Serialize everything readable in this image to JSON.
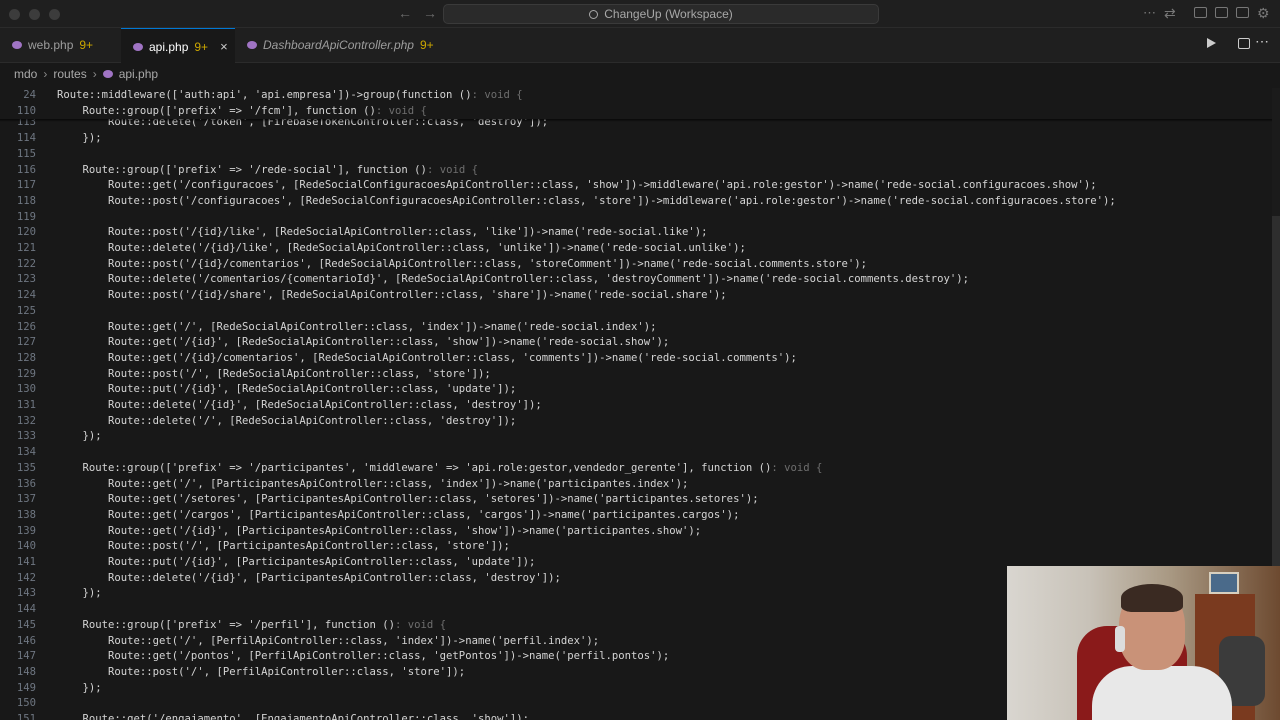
{
  "titlebar": {
    "workspace_title": "ChangeUp (Workspace)"
  },
  "tabs": [
    {
      "label": "web.php",
      "count": "9+"
    },
    {
      "label": "api.php",
      "count": "9+",
      "close": "×"
    },
    {
      "label": "DashboardApiController.php",
      "count": "9+"
    }
  ],
  "breadcrumb": {
    "part1": "mdo",
    "part2": "routes",
    "part3": "api.php",
    "separator": "›"
  },
  "sticky_lines": [
    {
      "num": "24",
      "code": "Route::middleware(['auth:api', 'api.empresa'])->group(function ()",
      "hint": ": void {"
    },
    {
      "num": "110",
      "code": "    Route::group(['prefix' => '/fcm'], function ()",
      "hint": ": void {"
    }
  ],
  "lines": [
    {
      "num": "113",
      "code": "        Route::delete('/token', [FirebaseTokenController::class, 'destroy']);"
    },
    {
      "num": "114",
      "code": "    });"
    },
    {
      "num": "115",
      "code": ""
    },
    {
      "num": "116",
      "code": "    Route::group(['prefix' => '/rede-social'], function ()",
      "hint": ": void {"
    },
    {
      "num": "117",
      "code": "        Route::get('/configuracoes', [RedeSocialConfiguracoesApiController::class, 'show'])->middleware('api.role:gestor')->name('rede-social.configuracoes.show');"
    },
    {
      "num": "118",
      "code": "        Route::post('/configuracoes', [RedeSocialConfiguracoesApiController::class, 'store'])->middleware('api.role:gestor')->name('rede-social.configuracoes.store');"
    },
    {
      "num": "119",
      "code": ""
    },
    {
      "num": "120",
      "code": "        Route::post('/{id}/like', [RedeSocialApiController::class, 'like'])->name('rede-social.like');"
    },
    {
      "num": "121",
      "code": "        Route::delete('/{id}/like', [RedeSocialApiController::class, 'unlike'])->name('rede-social.unlike');"
    },
    {
      "num": "122",
      "code": "        Route::post('/{id}/comentarios', [RedeSocialApiController::class, 'storeComment'])->name('rede-social.comments.store');"
    },
    {
      "num": "123",
      "code": "        Route::delete('/comentarios/{comentarioId}', [RedeSocialApiController::class, 'destroyComment'])->name('rede-social.comments.destroy');"
    },
    {
      "num": "124",
      "code": "        Route::post('/{id}/share', [RedeSocialApiController::class, 'share'])->name('rede-social.share');"
    },
    {
      "num": "125",
      "code": ""
    },
    {
      "num": "126",
      "code": "        Route::get('/', [RedeSocialApiController::class, 'index'])->name('rede-social.index');"
    },
    {
      "num": "127",
      "code": "        Route::get('/{id}', [RedeSocialApiController::class, 'show'])->name('rede-social.show');"
    },
    {
      "num": "128",
      "code": "        Route::get('/{id}/comentarios', [RedeSocialApiController::class, 'comments'])->name('rede-social.comments');"
    },
    {
      "num": "129",
      "code": "        Route::post('/', [RedeSocialApiController::class, 'store']);"
    },
    {
      "num": "130",
      "code": "        Route::put('/{id}', [RedeSocialApiController::class, 'update']);"
    },
    {
      "num": "131",
      "code": "        Route::delete('/{id}', [RedeSocialApiController::class, 'destroy']);"
    },
    {
      "num": "132",
      "code": "        Route::delete('/', [RedeSocialApiController::class, 'destroy']);"
    },
    {
      "num": "133",
      "code": "    });"
    },
    {
      "num": "134",
      "code": ""
    },
    {
      "num": "135",
      "code": "    Route::group(['prefix' => '/participantes', 'middleware' => 'api.role:gestor,vendedor_gerente'], function ()",
      "hint": ": void {"
    },
    {
      "num": "136",
      "code": "        Route::get('/', [ParticipantesApiController::class, 'index'])->name('participantes.index');"
    },
    {
      "num": "137",
      "code": "        Route::get('/setores', [ParticipantesApiController::class, 'setores'])->name('participantes.setores');"
    },
    {
      "num": "138",
      "code": "        Route::get('/cargos', [ParticipantesApiController::class, 'cargos'])->name('participantes.cargos');"
    },
    {
      "num": "139",
      "code": "        Route::get('/{id}', [ParticipantesApiController::class, 'show'])->name('participantes.show');"
    },
    {
      "num": "140",
      "code": "        Route::post('/', [ParticipantesApiController::class, 'store']);"
    },
    {
      "num": "141",
      "code": "        Route::put('/{id}', [ParticipantesApiController::class, 'update']);"
    },
    {
      "num": "142",
      "code": "        Route::delete('/{id}', [ParticipantesApiController::class, 'destroy']);"
    },
    {
      "num": "143",
      "code": "    });"
    },
    {
      "num": "144",
      "code": ""
    },
    {
      "num": "145",
      "code": "    Route::group(['prefix' => '/perfil'], function ()",
      "hint": ": void {"
    },
    {
      "num": "146",
      "code": "        Route::get('/', [PerfilApiController::class, 'index'])->name('perfil.index');"
    },
    {
      "num": "147",
      "code": "        Route::get('/pontos', [PerfilApiController::class, 'getPontos'])->name('perfil.pontos');"
    },
    {
      "num": "148",
      "code": "        Route::post('/', [PerfilApiController::class, 'store']);"
    },
    {
      "num": "149",
      "code": "    });"
    },
    {
      "num": "150",
      "code": ""
    },
    {
      "num": "151",
      "code": "    Route::get('/engajamento', [EngajamentoApiController::class, 'show']);"
    }
  ]
}
